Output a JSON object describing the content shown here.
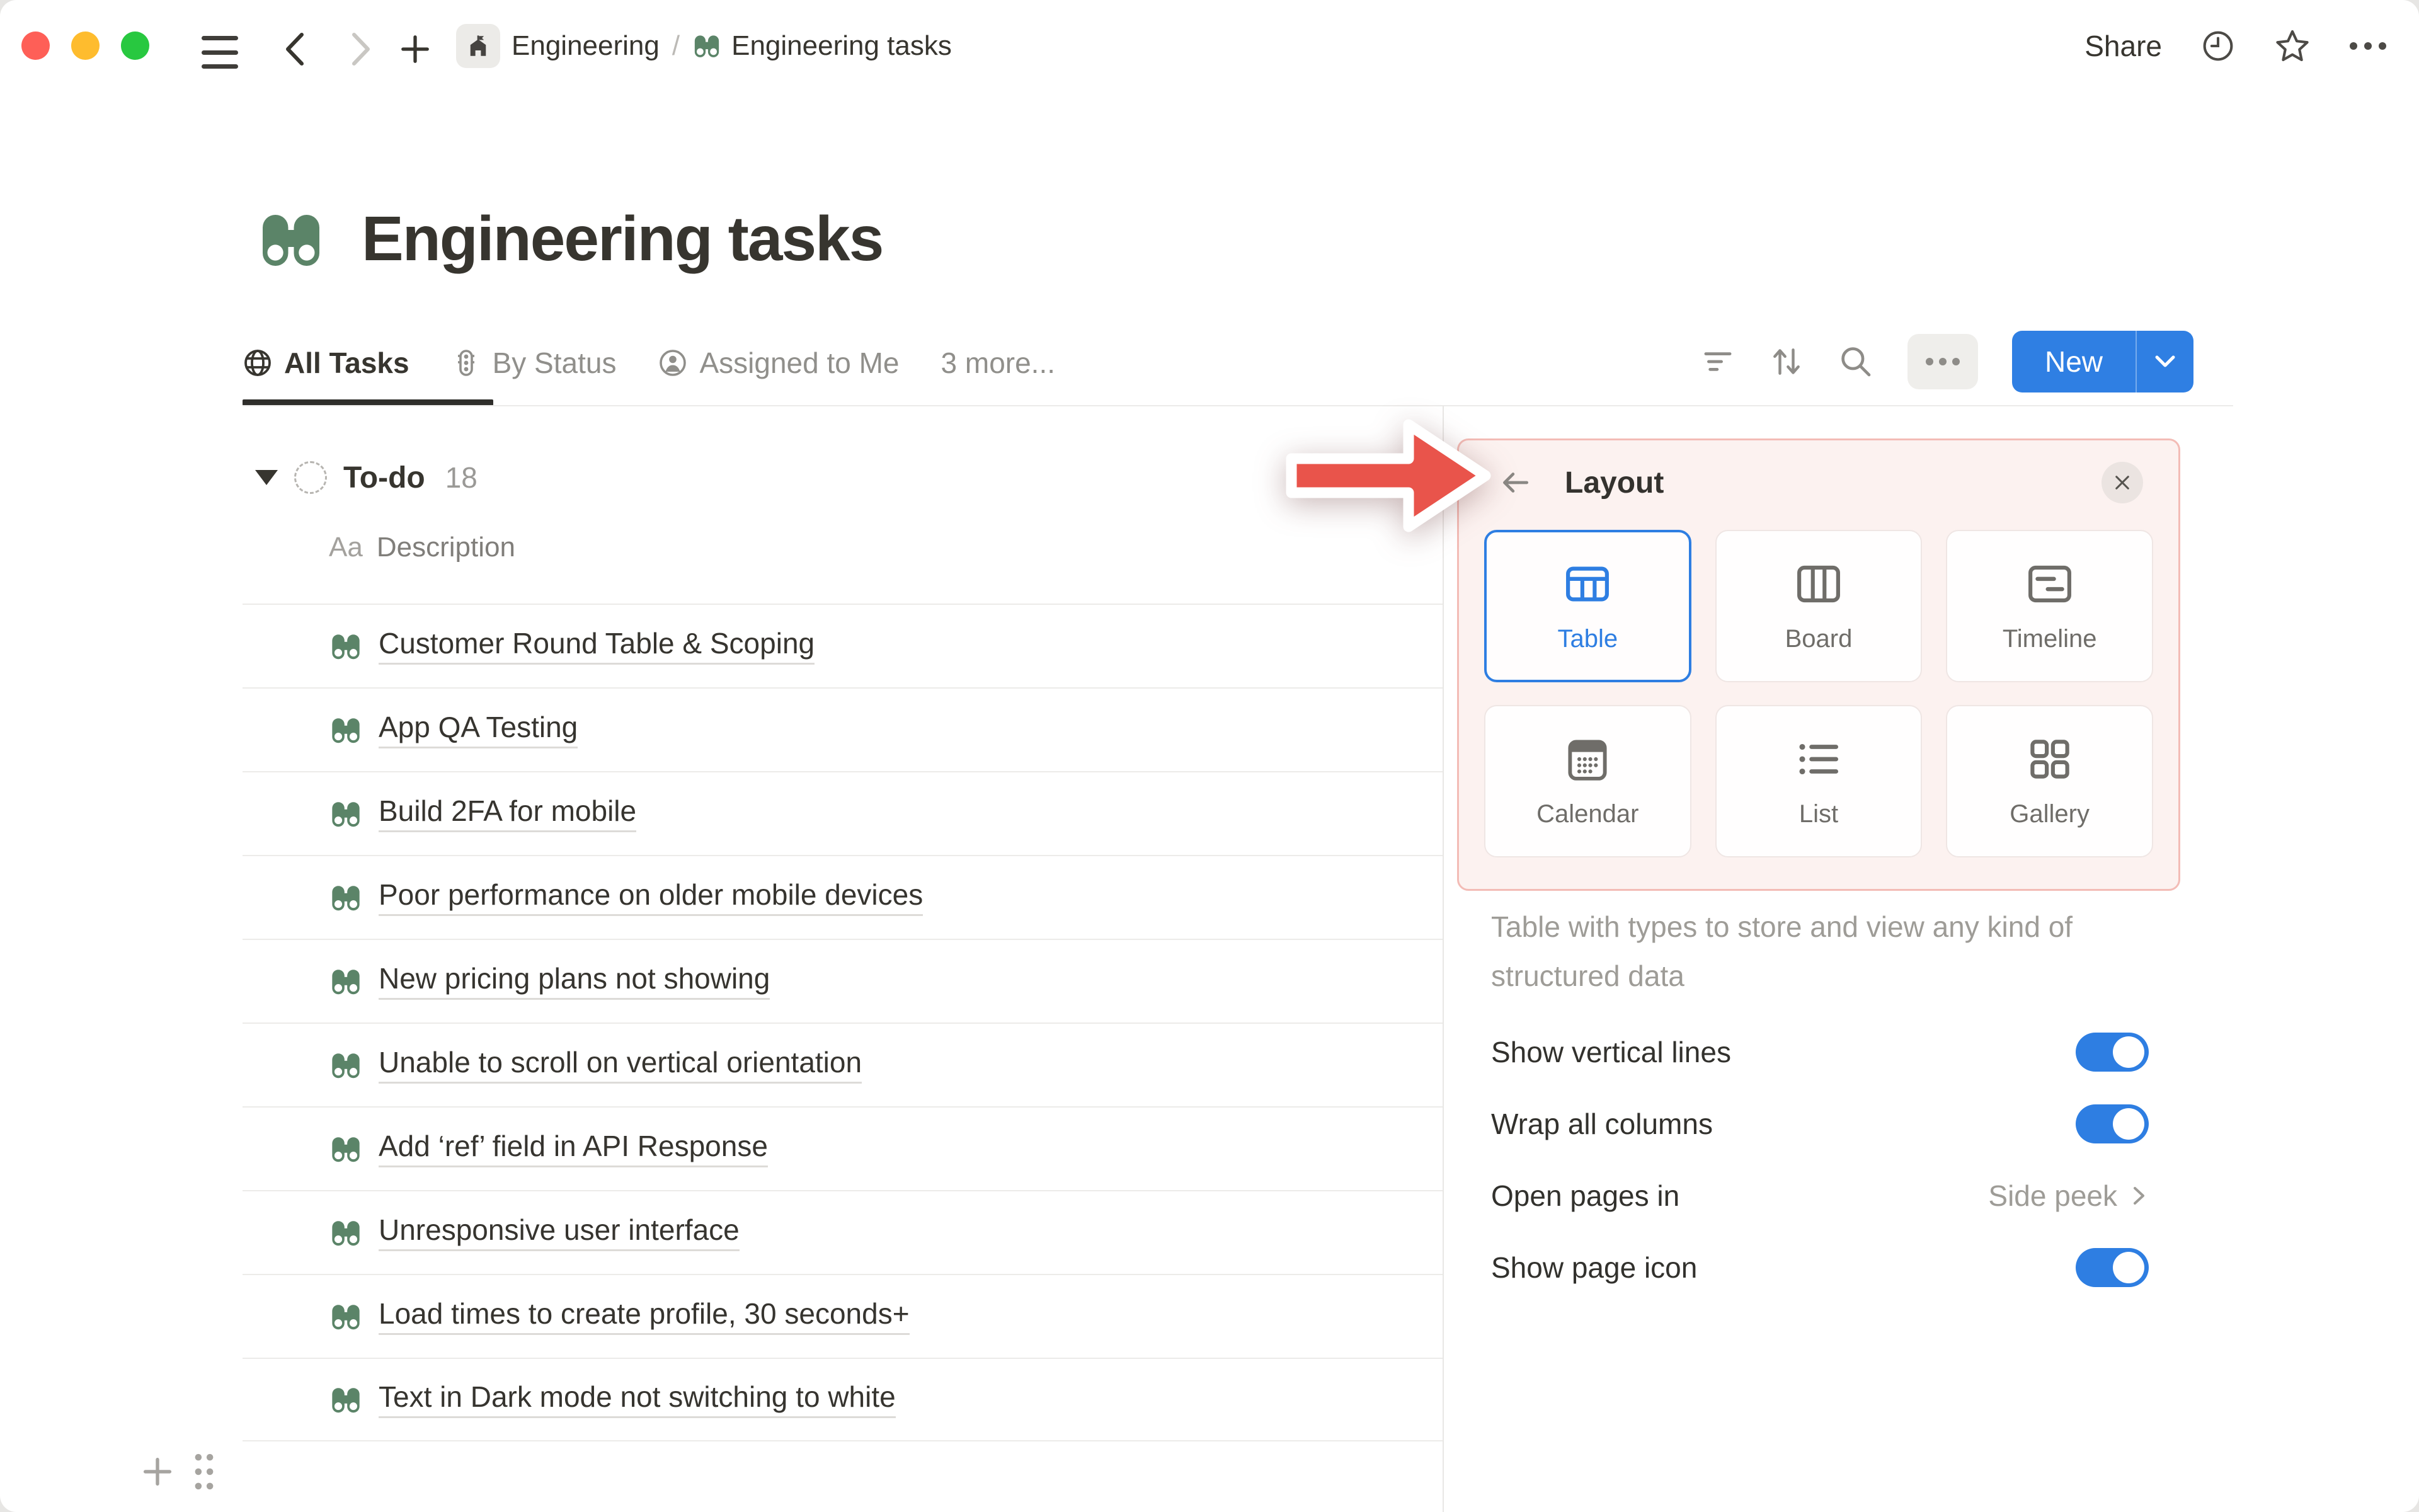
{
  "titlebar": {
    "breadcrumb": {
      "teamspace": "Engineering",
      "separator": "/",
      "page": "Engineering tasks"
    },
    "share_label": "Share"
  },
  "page": {
    "title": "Engineering tasks",
    "icon": "binoculars-green"
  },
  "tabs": [
    {
      "label": "All Tasks",
      "icon": "globe-icon",
      "active": true
    },
    {
      "label": "By Status",
      "icon": "status-light-icon",
      "active": false
    },
    {
      "label": "Assigned to Me",
      "icon": "person-circle-icon",
      "active": false
    },
    {
      "label": "3 more...",
      "icon": "",
      "active": false
    }
  ],
  "toolbar": {
    "new_label": "New"
  },
  "group": {
    "name": "To-do",
    "count": "18",
    "status_icon": "dashed-circle"
  },
  "table": {
    "column_header": {
      "type_label": "Aa",
      "name": "Description"
    },
    "rows": [
      "Customer Round Table & Scoping",
      "App QA Testing",
      "Build 2FA for mobile",
      "Poor performance on older mobile devices",
      "New pricing plans not showing",
      "Unable to scroll on vertical orientation",
      "Add ‘ref’ field in API Response",
      "Unresponsive user interface",
      "Load times to create profile, 30 seconds+",
      "Text in Dark mode not switching to white"
    ]
  },
  "layout_panel": {
    "title": "Layout",
    "options": [
      {
        "label": "Table",
        "icon": "table-icon",
        "selected": true
      },
      {
        "label": "Board",
        "icon": "board-icon",
        "selected": false
      },
      {
        "label": "Timeline",
        "icon": "timeline-icon",
        "selected": false
      },
      {
        "label": "Calendar",
        "icon": "calendar-icon",
        "selected": false
      },
      {
        "label": "List",
        "icon": "list-icon",
        "selected": false
      },
      {
        "label": "Gallery",
        "icon": "gallery-icon",
        "selected": false
      }
    ],
    "description": "Table with types to store and view any kind of structured data",
    "settings": [
      {
        "label": "Show vertical lines",
        "control": "toggle",
        "value": "on"
      },
      {
        "label": "Wrap all columns",
        "control": "toggle",
        "value": "on"
      },
      {
        "label": "Open pages in",
        "control": "link",
        "value": "Side peek"
      },
      {
        "label": "Show page icon",
        "control": "toggle",
        "value": "on"
      }
    ]
  },
  "annotation": {
    "type": "arrow-right",
    "color": "#E9544B"
  },
  "colors": {
    "accent_blue": "#2E7EE2",
    "page_green": "#5B8468",
    "highlight_pink_bg": "#FCF2F0",
    "highlight_pink_border": "#F3BCB6",
    "arrow_red": "#E9544B",
    "text_dark": "#37352F",
    "text_gray": "#908F8B",
    "border_gray": "#ECEBE9",
    "traffic_red": "#FE5F57",
    "traffic_yellow": "#FEBC2E",
    "traffic_green": "#28C840"
  }
}
